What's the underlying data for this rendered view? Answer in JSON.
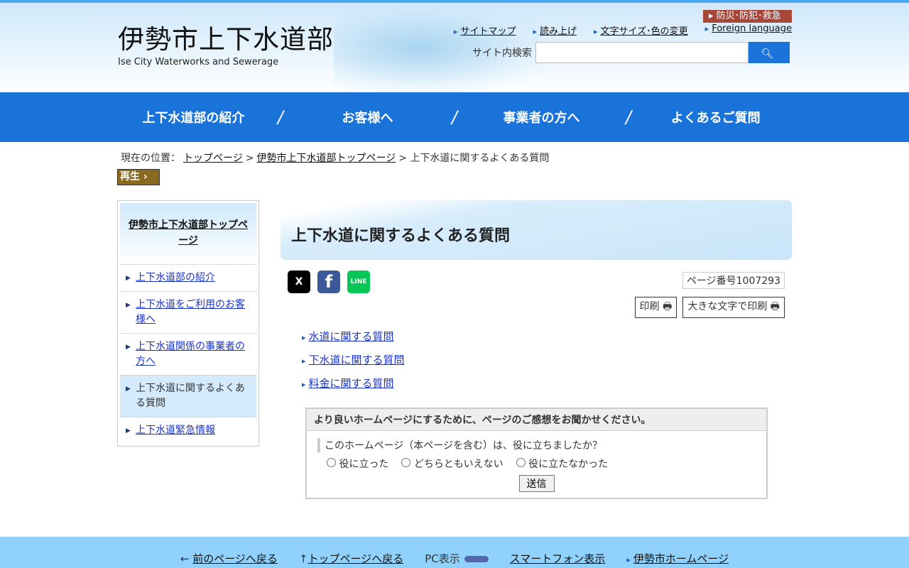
{
  "header": {
    "logo_jp": "伊勢市上下水道部",
    "logo_en": "Ise City Waterworks and Sewerage",
    "disaster": "防災･防犯･救急",
    "links": [
      "サイトマップ",
      "読み上げ",
      "文字サイズ･色の変更",
      "Foreign language"
    ],
    "search_label": "サイト内検索",
    "search_value": "",
    "search_icon": "magnifier-icon"
  },
  "nav": [
    "上下水道部の紹介",
    "お客様へ",
    "事業者の方へ",
    "よくあるご質問"
  ],
  "breadcrumb": {
    "prefix": "現在の位置：",
    "items": [
      "トップページ",
      "伊勢市上下水道部トップページ"
    ],
    "current": "上下水道に関するよくある質問",
    "sep": ">"
  },
  "play": "再生",
  "sidebar": {
    "head": "伊勢市上下水道部トップページ",
    "items": [
      "上下水道部の紹介",
      "上下水道をご利用のお客様へ",
      "上下水道関係の事業者の方へ",
      "上下水道に関するよくある質問",
      "上下水道緊急情報"
    ]
  },
  "main": {
    "title": "上下水道に関するよくある質問",
    "page_number": "ページ番号1007293",
    "print": "印刷",
    "print_large": "大きな文字で印刷",
    "social": [
      "X",
      "f",
      "LINE"
    ],
    "links": [
      "水道に関する質問",
      "下水道に関する質問",
      "料金に関する質問"
    ]
  },
  "survey": {
    "heading": "より良いホームページにするために、ページのご感想をお聞かせください。",
    "question": "このホームページ（本ページを含む）は、役に立ちましたか？",
    "options": [
      "役に立った",
      "どちらともいえない",
      "役に立たなかった"
    ],
    "submit": "送信"
  },
  "footer": {
    "back": "前のページへ戻る",
    "top": "トップページへ戻る",
    "pc": "PC表示",
    "sp": "スマートフォン表示",
    "city": "伊勢市ホームページ"
  }
}
